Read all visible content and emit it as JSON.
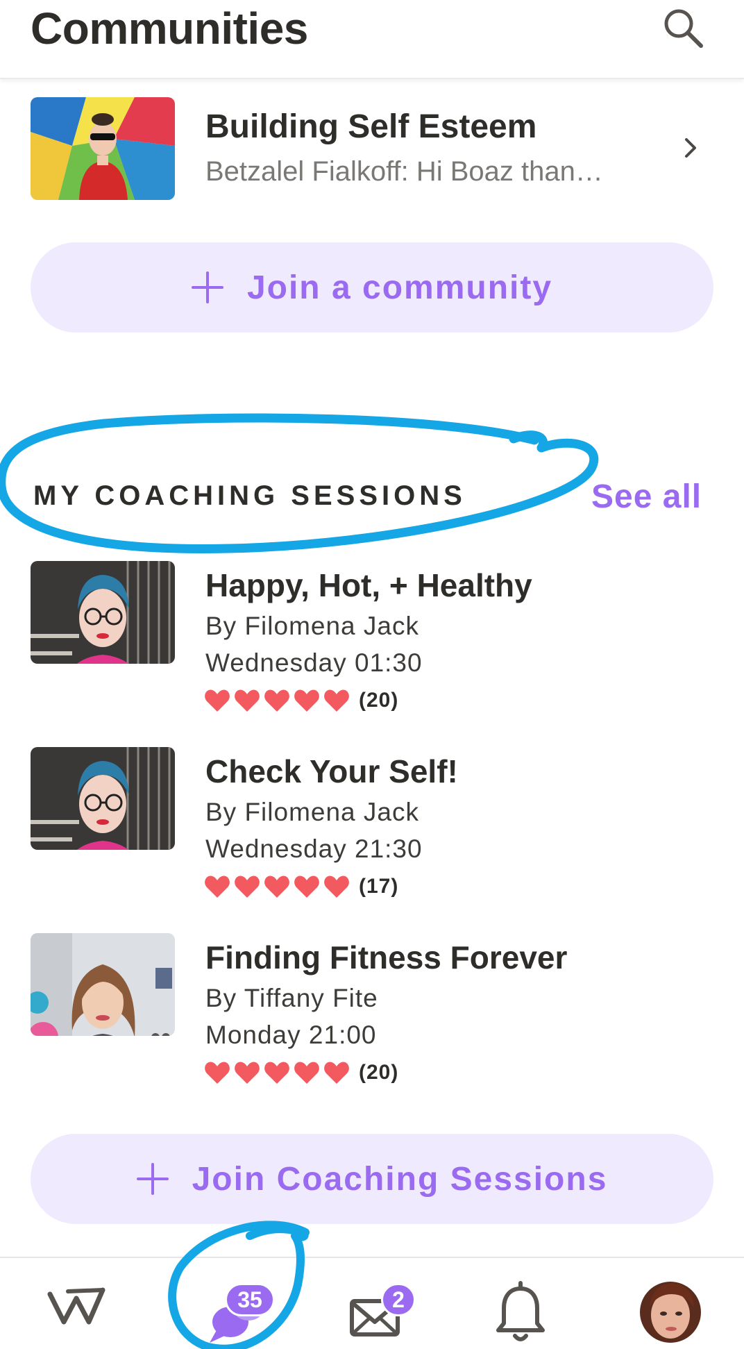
{
  "header": {
    "title": "Communities",
    "search_icon": "search-icon"
  },
  "communities": [
    {
      "title": "Building Self Esteem",
      "preview": "Betzalel Fialkoff: Hi Boaz than…",
      "chevron_icon": "chevron-right-icon"
    }
  ],
  "join_community": {
    "label": "Join a community",
    "icon": "plus-icon"
  },
  "coaching": {
    "section_title": "MY COACHING SESSIONS",
    "see_all": "See all",
    "sessions": [
      {
        "title": "Happy, Hot, + Healthy",
        "coach": "By Filomena Jack",
        "time": "Wednesday 01:30",
        "rating": 5,
        "count": "(20)"
      },
      {
        "title": "Check Your Self!",
        "coach": "By Filomena Jack",
        "time": "Wednesday 21:30",
        "rating": 5,
        "count": "(17)"
      },
      {
        "title": "Finding Fitness Forever",
        "coach": "By Tiffany Fite",
        "time": "Monday 21:00",
        "rating": 5,
        "count": "(20)"
      }
    ],
    "join_label": "Join Coaching Sessions"
  },
  "nav": {
    "items": [
      {
        "icon": "home-logo-icon"
      },
      {
        "icon": "chat-bubbles-icon",
        "badge": "35"
      },
      {
        "icon": "mail-icon",
        "badge": "2"
      },
      {
        "icon": "bell-icon"
      },
      {
        "icon": "profile-avatar"
      }
    ]
  },
  "colors": {
    "accent": "#9a6bf0",
    "pill_bg": "#efeafe",
    "heart": "#f25a5f",
    "annotation": "#15a6e6"
  }
}
